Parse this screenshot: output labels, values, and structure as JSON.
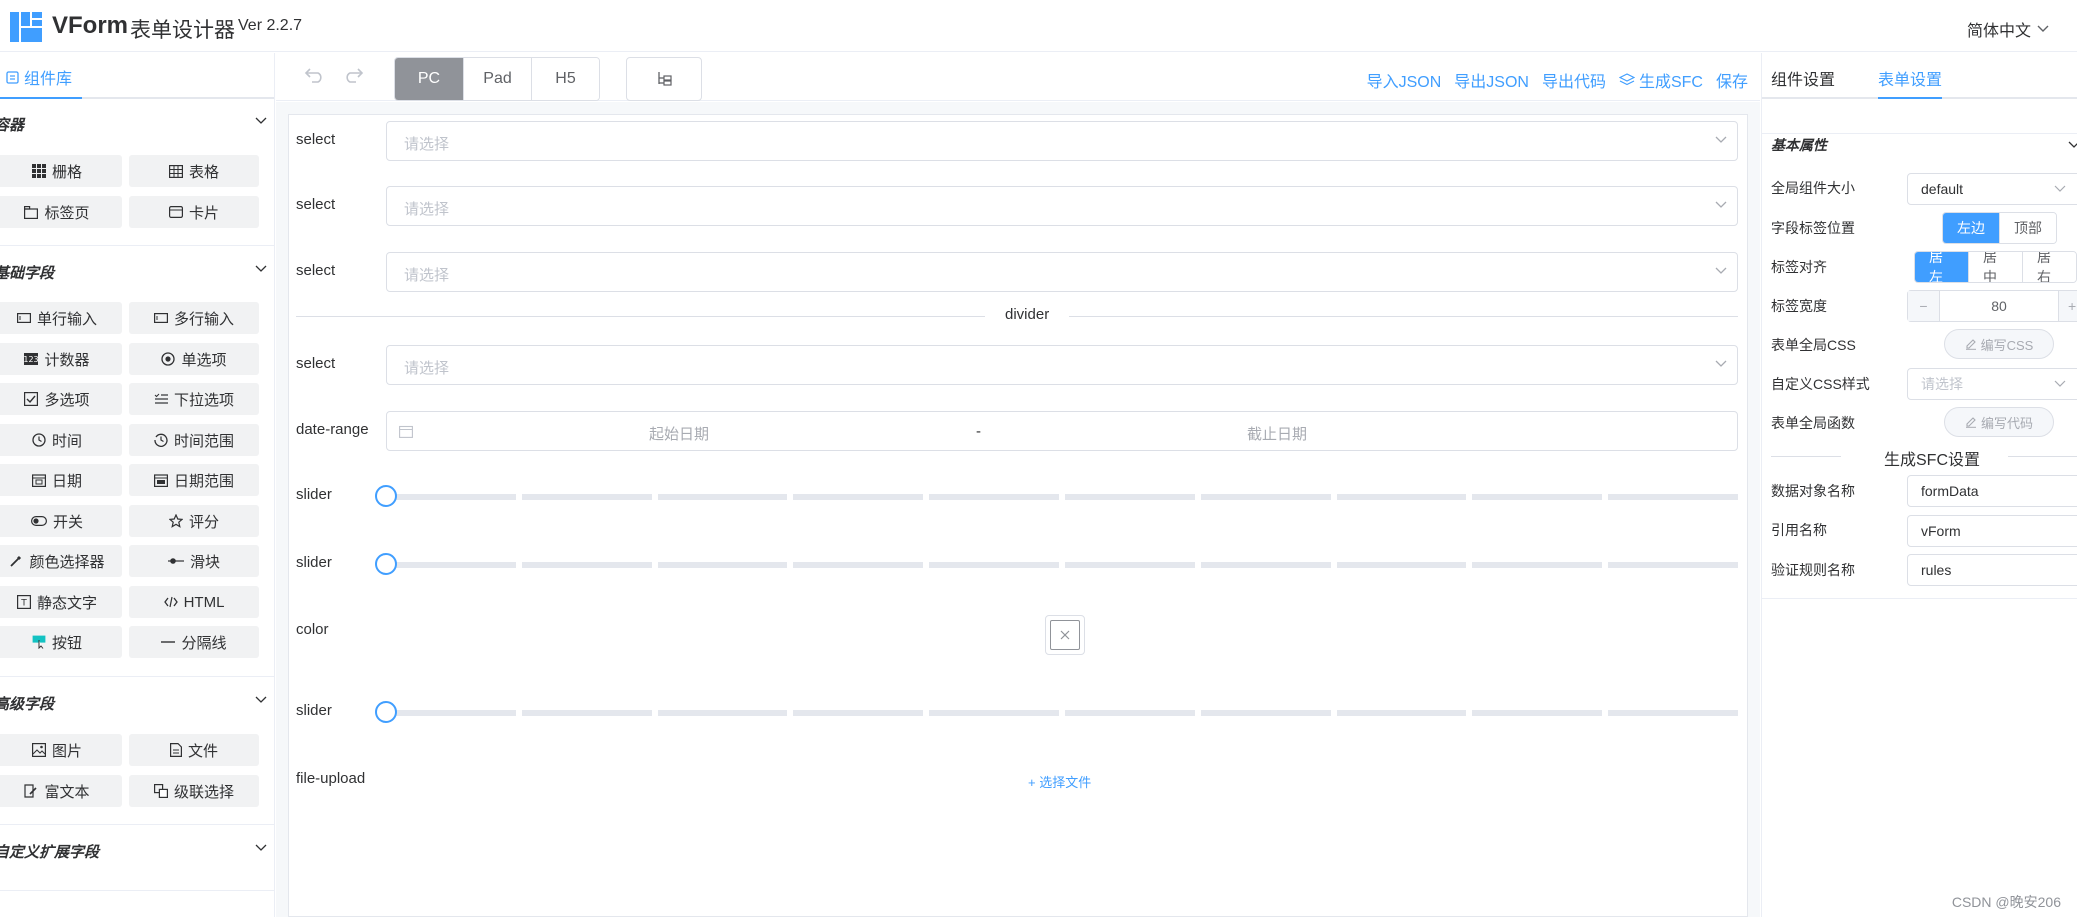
{
  "header": {
    "app_name": "VForm",
    "app_subtitle": "表单设计器",
    "version": "Ver 2.2.7",
    "language": "简体中文"
  },
  "left_panel": {
    "tab_label": "组件库",
    "sections": {
      "container": {
        "title": "容器",
        "items": [
          {
            "label": "栅格",
            "icon": "grid-icon"
          },
          {
            "label": "表格",
            "icon": "table-icon"
          },
          {
            "label": "标签页",
            "icon": "tabs-icon"
          },
          {
            "label": "卡片",
            "icon": "card-icon"
          }
        ]
      },
      "basic": {
        "title": "基础字段",
        "items": [
          {
            "label": "单行输入",
            "icon": "input-icon"
          },
          {
            "label": "多行输入",
            "icon": "textarea-icon"
          },
          {
            "label": "计数器",
            "icon": "counter-icon"
          },
          {
            "label": "单选项",
            "icon": "radio-icon"
          },
          {
            "label": "多选项",
            "icon": "checkbox-icon"
          },
          {
            "label": "下拉选项",
            "icon": "select-icon"
          },
          {
            "label": "时间",
            "icon": "clock-icon"
          },
          {
            "label": "时间范围",
            "icon": "time-range-icon"
          },
          {
            "label": "日期",
            "icon": "calendar-icon"
          },
          {
            "label": "日期范围",
            "icon": "date-range-icon"
          },
          {
            "label": "开关",
            "icon": "switch-icon"
          },
          {
            "label": "评分",
            "icon": "star-icon"
          },
          {
            "label": "颜色选择器",
            "icon": "color-picker-icon"
          },
          {
            "label": "滑块",
            "icon": "slider-icon"
          },
          {
            "label": "静态文字",
            "icon": "static-text-icon"
          },
          {
            "label": "HTML",
            "icon": "html-icon"
          },
          {
            "label": "按钮",
            "icon": "button-icon"
          },
          {
            "label": "分隔线",
            "icon": "divider-icon"
          }
        ]
      },
      "advanced": {
        "title": "高级字段",
        "items": [
          {
            "label": "图片",
            "icon": "picture-icon"
          },
          {
            "label": "文件",
            "icon": "file-icon"
          },
          {
            "label": "富文本",
            "icon": "rich-text-icon"
          },
          {
            "label": "级联选择",
            "icon": "cascader-icon"
          }
        ]
      },
      "custom": {
        "title": "自定义扩展字段"
      }
    }
  },
  "toolbar": {
    "devices": [
      "PC",
      "Pad",
      "H5"
    ],
    "active_device": "PC",
    "actions": {
      "import_json": "导入JSON",
      "export_json": "导出JSON",
      "export_code": "导出代码",
      "generate_sfc": "生成SFC",
      "save": "保存"
    }
  },
  "canvas": {
    "select_placeholder": "请选择",
    "fields": {
      "select1": "select",
      "select2": "select",
      "select3": "select",
      "divider": "divider",
      "select4": "select",
      "date_range": "date-range",
      "date_start": "起始日期",
      "date_sep": "-",
      "date_end": "截止日期",
      "slider1": "slider",
      "slider2": "slider",
      "color": "color",
      "slider3": "slider",
      "file_upload": "file-upload",
      "upload_label": "+ 选择文件"
    },
    "slider_values": [
      0,
      0,
      0
    ]
  },
  "right_panel": {
    "tabs": [
      "组件设置",
      "表单设置"
    ],
    "active_tab": "表单设置",
    "section_title": "基本属性",
    "rows": {
      "size_label": "全局组件大小",
      "size_value": "default",
      "label_pos_label": "字段标签位置",
      "label_pos_options": [
        "左边",
        "顶部"
      ],
      "label_pos_active": "左边",
      "align_label": "标签对齐",
      "align_options": [
        "居左",
        "居中",
        "居右"
      ],
      "align_active": "居左",
      "width_label": "标签宽度",
      "width_value": "80",
      "css_label": "表单全局CSS",
      "css_button": "编写CSS",
      "custom_css_label": "自定义CSS样式",
      "custom_css_placeholder": "请选择",
      "func_label": "表单全局函数",
      "func_button": "编写代码"
    },
    "sfc_title": "生成SFC设置",
    "sfc_rows": {
      "data_label": "数据对象名称",
      "data_value": "formData",
      "ref_label": "引用名称",
      "ref_value": "vForm",
      "rules_label": "验证规则名称",
      "rules_value": "rules"
    }
  },
  "watermark": "CSDN @晚安206",
  "colors": {
    "primary": "#409eff",
    "active_device_bg": "#909399",
    "widget_bg": "#f1f2f3",
    "canvas_bg": "#f6f8fa"
  }
}
